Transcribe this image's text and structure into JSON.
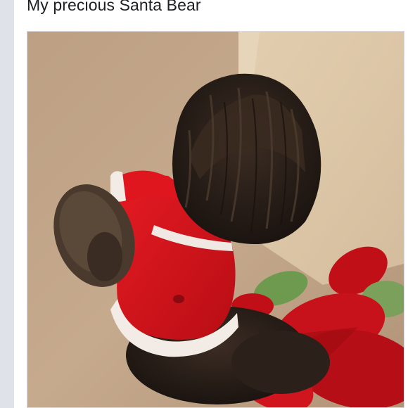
{
  "post": {
    "caption": "My precious Santa Bear"
  },
  "photo": {
    "subject_icon": "dog-in-santa-outfit-photo",
    "colors": {
      "carpet": "#c5a98c",
      "fur": "#2a1f1a",
      "santa_red": "#d3141c",
      "trim_white": "#f3ece6",
      "poinsettia_red": "#c10f18",
      "leaf_green": "#6e9a4f"
    }
  }
}
